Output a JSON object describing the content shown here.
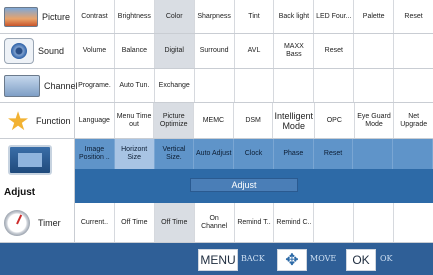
{
  "rows": [
    {
      "label": "Picture",
      "icon": "picture-icon",
      "items": [
        "Contrast",
        "Brightness",
        "Color",
        "Sharpness",
        "Tint",
        "Back light",
        "LED Four...",
        "Palette",
        "Reset"
      ],
      "selected": 2
    },
    {
      "label": "Sound",
      "icon": "speaker-icon",
      "items": [
        "Volume",
        "Balance",
        "Digital",
        "Surround",
        "AVL",
        "MAXX Bass",
        "Reset",
        "",
        ""
      ],
      "selected": 2
    },
    {
      "label": "Channel",
      "icon": "channel-icon",
      "items": [
        "Programe.",
        "Auto Tun.",
        "Exchange",
        "",
        "",
        "",
        "",
        "",
        ""
      ],
      "selected": -1
    },
    {
      "label": "Function",
      "icon": "star-icon",
      "items": [
        "Language",
        "Menu Time out",
        "Picture Optimize",
        "MEMC",
        "DSM",
        "Intelligent Mode",
        "OPC",
        "Eye Guard Mode",
        "Net Upgrade"
      ],
      "selected": 2
    },
    {
      "label": "Timer",
      "icon": "clock-icon",
      "items": [
        "Current..",
        "Off Time",
        "Off Time",
        "On Channel",
        "Remind T..",
        "Remind C..",
        "",
        "",
        ""
      ],
      "selected": 2
    }
  ],
  "adjust": {
    "label": "Adjust",
    "items": [
      "Image Position ..",
      "Horizont Size",
      "Vertical Size.",
      "Auto Adjust",
      "Clock",
      "Phase",
      "Reset",
      "",
      ""
    ],
    "selected": 1,
    "button": "Adjust"
  },
  "bottom": {
    "menu_key": "MENU",
    "menu_label": "BACK",
    "move_label": "MOVE",
    "ok_key": "OK",
    "ok_label": "OK"
  },
  "colors": {
    "accent": "#2d6aa7",
    "bar": "#2f5f97",
    "selected": "#d9dde3"
  }
}
